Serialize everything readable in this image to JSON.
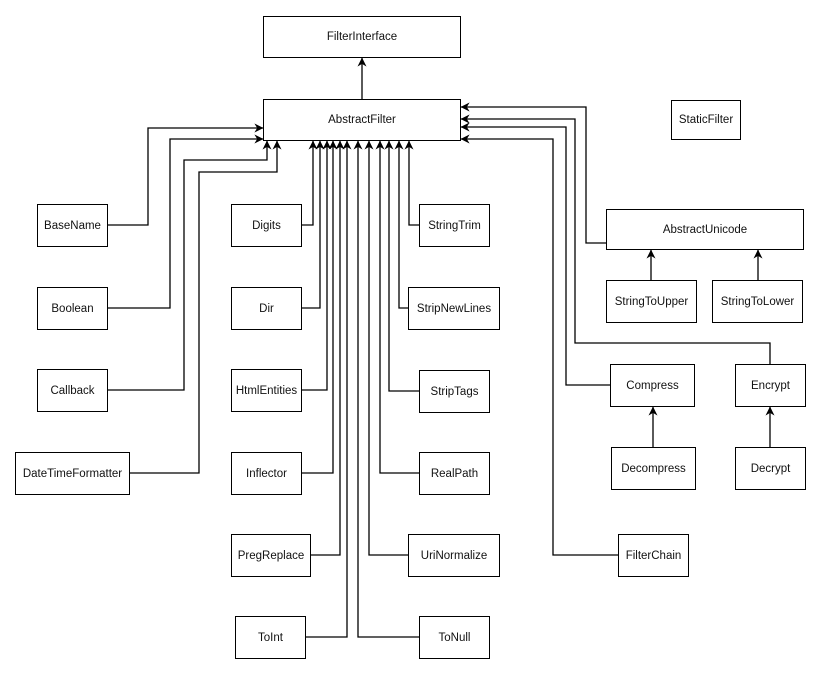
{
  "diagram": {
    "type": "class-hierarchy",
    "nodes": {
      "FilterInterface": "FilterInterface",
      "AbstractFilter": "AbstractFilter",
      "StaticFilter": "StaticFilter",
      "BaseName": "BaseName",
      "Boolean": "Boolean",
      "Callback": "Callback",
      "DateTimeFormatter": "DateTimeFormatter",
      "Digits": "Digits",
      "Dir": "Dir",
      "HtmlEntities": "HtmlEntities",
      "Inflector": "Inflector",
      "PregReplace": "PregReplace",
      "ToInt": "ToInt",
      "StringTrim": "StringTrim",
      "StripNewLines": "StripNewLines",
      "StripTags": "StripTags",
      "RealPath": "RealPath",
      "UriNormalize": "UriNormalize",
      "ToNull": "ToNull",
      "AbstractUnicode": "AbstractUnicode",
      "StringToUpper": "StringToUpper",
      "StringToLower": "StringToLower",
      "Compress": "Compress",
      "Decompress": "Decompress",
      "Encrypt": "Encrypt",
      "Decrypt": "Decrypt",
      "FilterChain": "FilterChain"
    },
    "edges": [
      {
        "from": "AbstractFilter",
        "to": "FilterInterface"
      },
      {
        "from": "BaseName",
        "to": "AbstractFilter"
      },
      {
        "from": "Boolean",
        "to": "AbstractFilter"
      },
      {
        "from": "Callback",
        "to": "AbstractFilter"
      },
      {
        "from": "DateTimeFormatter",
        "to": "AbstractFilter"
      },
      {
        "from": "Digits",
        "to": "AbstractFilter"
      },
      {
        "from": "Dir",
        "to": "AbstractFilter"
      },
      {
        "from": "HtmlEntities",
        "to": "AbstractFilter"
      },
      {
        "from": "Inflector",
        "to": "AbstractFilter"
      },
      {
        "from": "PregReplace",
        "to": "AbstractFilter"
      },
      {
        "from": "ToInt",
        "to": "AbstractFilter"
      },
      {
        "from": "ToNull",
        "to": "AbstractFilter"
      },
      {
        "from": "UriNormalize",
        "to": "AbstractFilter"
      },
      {
        "from": "RealPath",
        "to": "AbstractFilter"
      },
      {
        "from": "StripTags",
        "to": "AbstractFilter"
      },
      {
        "from": "StripNewLines",
        "to": "AbstractFilter"
      },
      {
        "from": "StringTrim",
        "to": "AbstractFilter"
      },
      {
        "from": "AbstractUnicode",
        "to": "AbstractFilter"
      },
      {
        "from": "Encrypt",
        "to": "AbstractFilter"
      },
      {
        "from": "Compress",
        "to": "AbstractFilter"
      },
      {
        "from": "FilterChain",
        "to": "AbstractFilter"
      },
      {
        "from": "StringToUpper",
        "to": "AbstractUnicode"
      },
      {
        "from": "StringToLower",
        "to": "AbstractUnicode"
      },
      {
        "from": "Decompress",
        "to": "Compress"
      },
      {
        "from": "Decrypt",
        "to": "Encrypt"
      }
    ]
  }
}
